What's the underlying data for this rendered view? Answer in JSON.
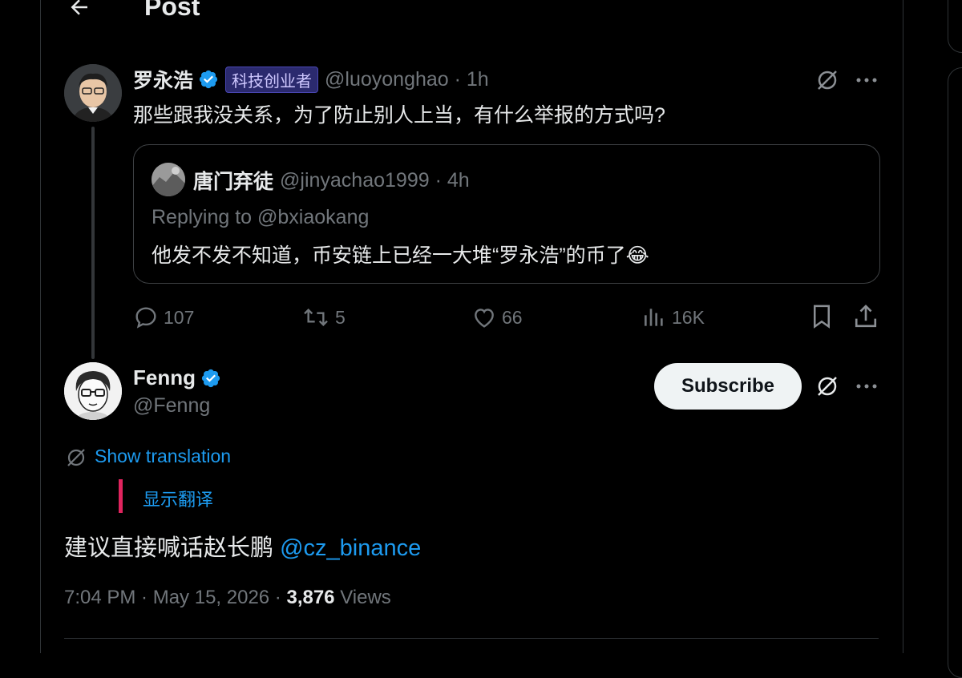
{
  "header": {
    "title": "Post"
  },
  "parent_tweet": {
    "author_name": "罗永浩",
    "affiliation_badge": "科技创业者",
    "handle": "@luoyonghao",
    "time": "1h",
    "text": "那些跟我没关系，为了防止别人上当，有什么举报的方式吗?",
    "quote": {
      "author_name": "唐门弃徒",
      "handle": "@jinyachao1999",
      "time": "4h",
      "replying_to": "Replying to @bxiaokang",
      "text": "他发不发不知道，币安链上已经一大堆“罗永浩”的币了😂"
    },
    "stats": {
      "replies": "107",
      "reposts": "5",
      "likes": "66",
      "views": "16K"
    }
  },
  "main_tweet": {
    "author_name": "Fenng",
    "handle": "@Fenng",
    "subscribe_label": "Subscribe",
    "show_translation": "Show translation",
    "translation_text": "显示翻译",
    "text": "建议直接喊话赵长鹏",
    "mention": "@cz_binance",
    "time": "7:04 PM · May 15, 2026 · ",
    "views_count": "3,876",
    "views_label": " Views"
  },
  "colors": {
    "accent": "#1d9bf0",
    "verified": "#1d9bf0",
    "background": "#000000",
    "muted": "#71767b"
  }
}
